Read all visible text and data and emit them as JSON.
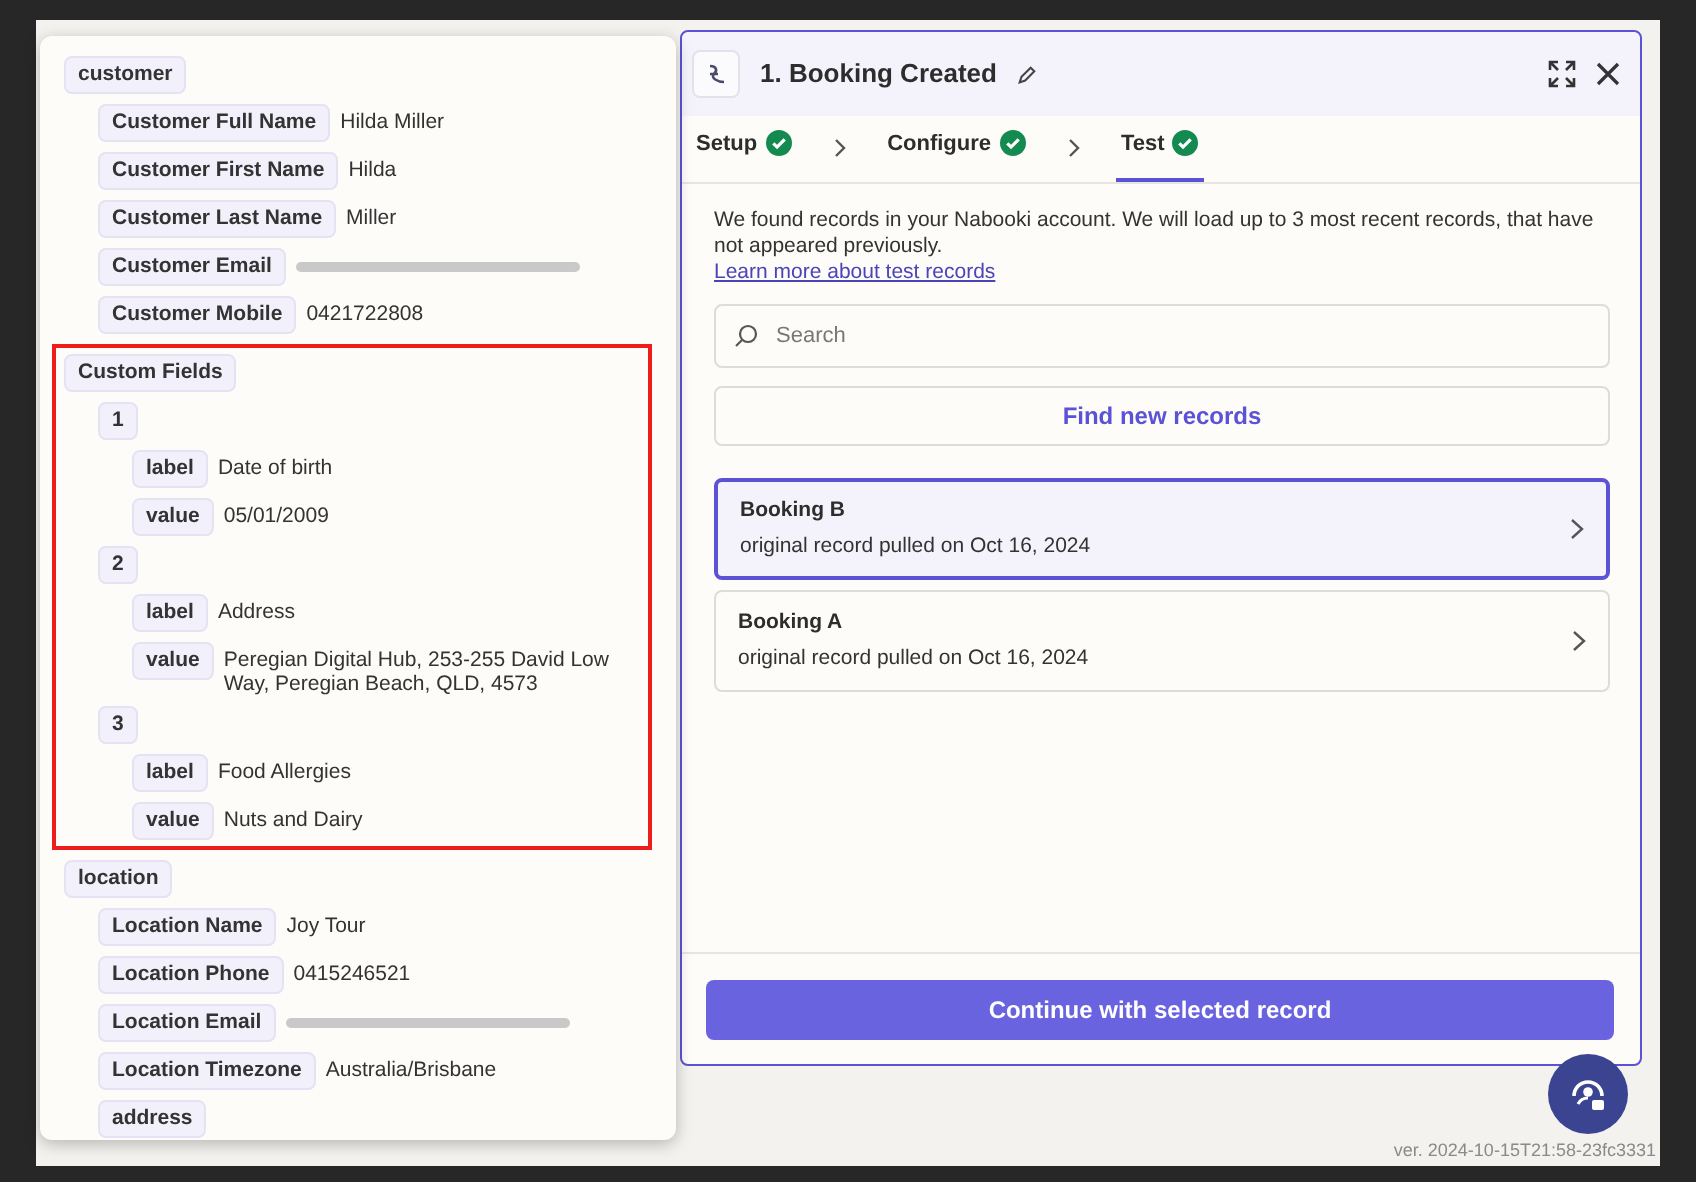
{
  "tree": [
    {
      "key": "customer",
      "children": [
        {
          "key": "Customer Full Name",
          "value": "Hilda Miller"
        },
        {
          "key": "Customer First Name",
          "value": "Hilda"
        },
        {
          "key": "Customer Last Name",
          "value": "Miller"
        },
        {
          "key": "Customer Email",
          "redacted": true
        },
        {
          "key": "Customer Mobile",
          "value": "0421722808"
        }
      ]
    },
    {
      "key": "Custom Fields",
      "highlighted": true,
      "children": [
        {
          "key": "1",
          "children": [
            {
              "key": "label",
              "value": "Date of birth"
            },
            {
              "key": "value",
              "value": "05/01/2009"
            }
          ]
        },
        {
          "key": "2",
          "children": [
            {
              "key": "label",
              "value": "Address"
            },
            {
              "key": "value",
              "value": "Peregian Digital Hub, 253-255 David Low Way, Peregian Beach, QLD, 4573"
            }
          ]
        },
        {
          "key": "3",
          "children": [
            {
              "key": "label",
              "value": "Food Allergies"
            },
            {
              "key": "value",
              "value": "Nuts and Dairy"
            }
          ]
        }
      ]
    },
    {
      "key": "location",
      "children": [
        {
          "key": "Location Name",
          "value": "Joy Tour"
        },
        {
          "key": "Location Phone",
          "value": "0415246521"
        },
        {
          "key": "Location Email",
          "redacted": true
        },
        {
          "key": "Location Timezone",
          "value": "Australia/Brisbane"
        },
        {
          "key": "address"
        }
      ]
    }
  ],
  "panel": {
    "title": "1. Booking Created",
    "steps": [
      {
        "label": "Setup",
        "done": true,
        "selected": false
      },
      {
        "label": "Configure",
        "done": true,
        "selected": false
      },
      {
        "label": "Test",
        "done": true,
        "selected": true
      }
    ],
    "intro": "We found records in your Nabooki account. We will load up to 3 most recent records, that have not appeared previously.",
    "link": "Learn more about test records",
    "search": {
      "placeholder": "Search"
    },
    "find_button": "Find new records",
    "records": [
      {
        "title": "Booking B",
        "subtitle": "original record pulled on Oct 16, 2024",
        "selected": true
      },
      {
        "title": "Booking A",
        "subtitle": "original record pulled on Oct 16, 2024",
        "selected": false
      }
    ],
    "continue_button": "Continue with selected record"
  },
  "version": "ver. 2024-10-15T21:58-23fc3331"
}
